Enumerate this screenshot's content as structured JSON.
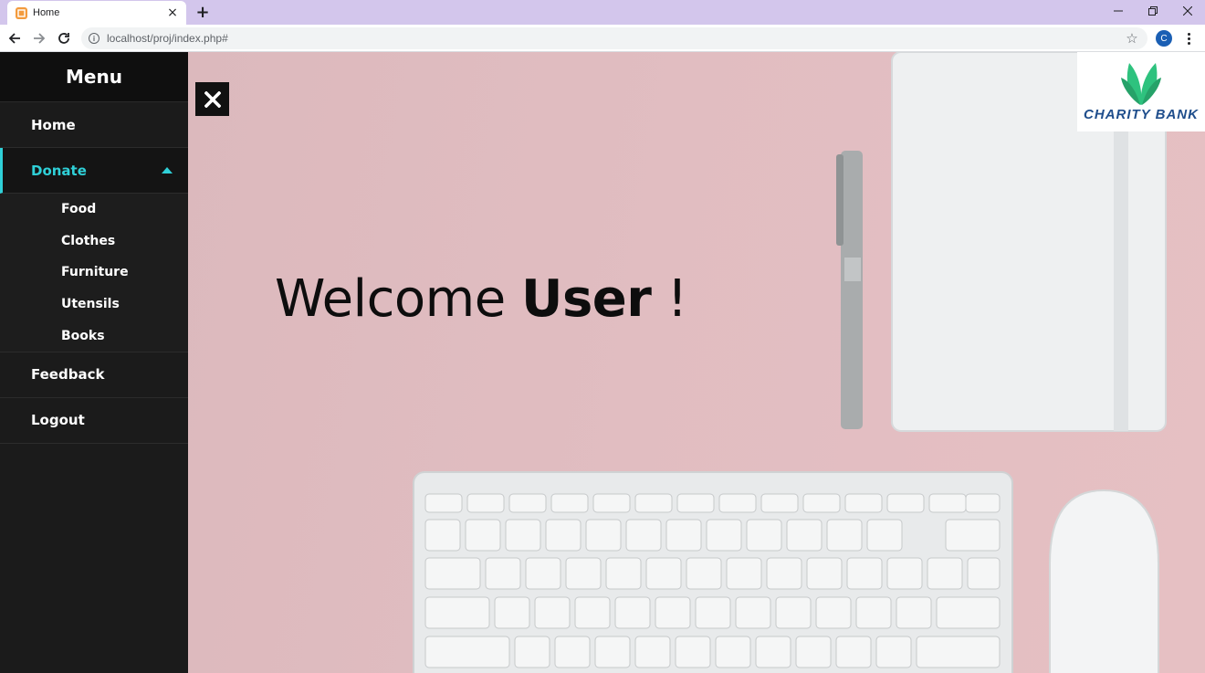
{
  "browser": {
    "tab_title": "Home",
    "tab_close": "×",
    "new_tab": "+",
    "url": "localhost/proj/index.php#",
    "profile_initial": "C"
  },
  "sidebar": {
    "title": "Menu",
    "items": [
      {
        "label": "Home"
      },
      {
        "label": "Donate",
        "active": true
      },
      {
        "label": "Feedback"
      },
      {
        "label": "Logout"
      }
    ],
    "donate_sub": [
      {
        "label": "Food"
      },
      {
        "label": "Clothes"
      },
      {
        "label": "Furniture"
      },
      {
        "label": "Utensils"
      },
      {
        "label": "Books"
      }
    ]
  },
  "hero": {
    "welcome_prefix": "Welcome",
    "welcome_user": "User",
    "welcome_suffix": "!"
  },
  "logo": {
    "text": "CHARITY BANK"
  },
  "colors": {
    "accent": "#2fd0d8",
    "sidebar_bg": "#1b1b1b",
    "hero_bg": "#dcb9bd",
    "logo_text": "#1f4e8c",
    "logo_leaf": "#2ec27e"
  }
}
